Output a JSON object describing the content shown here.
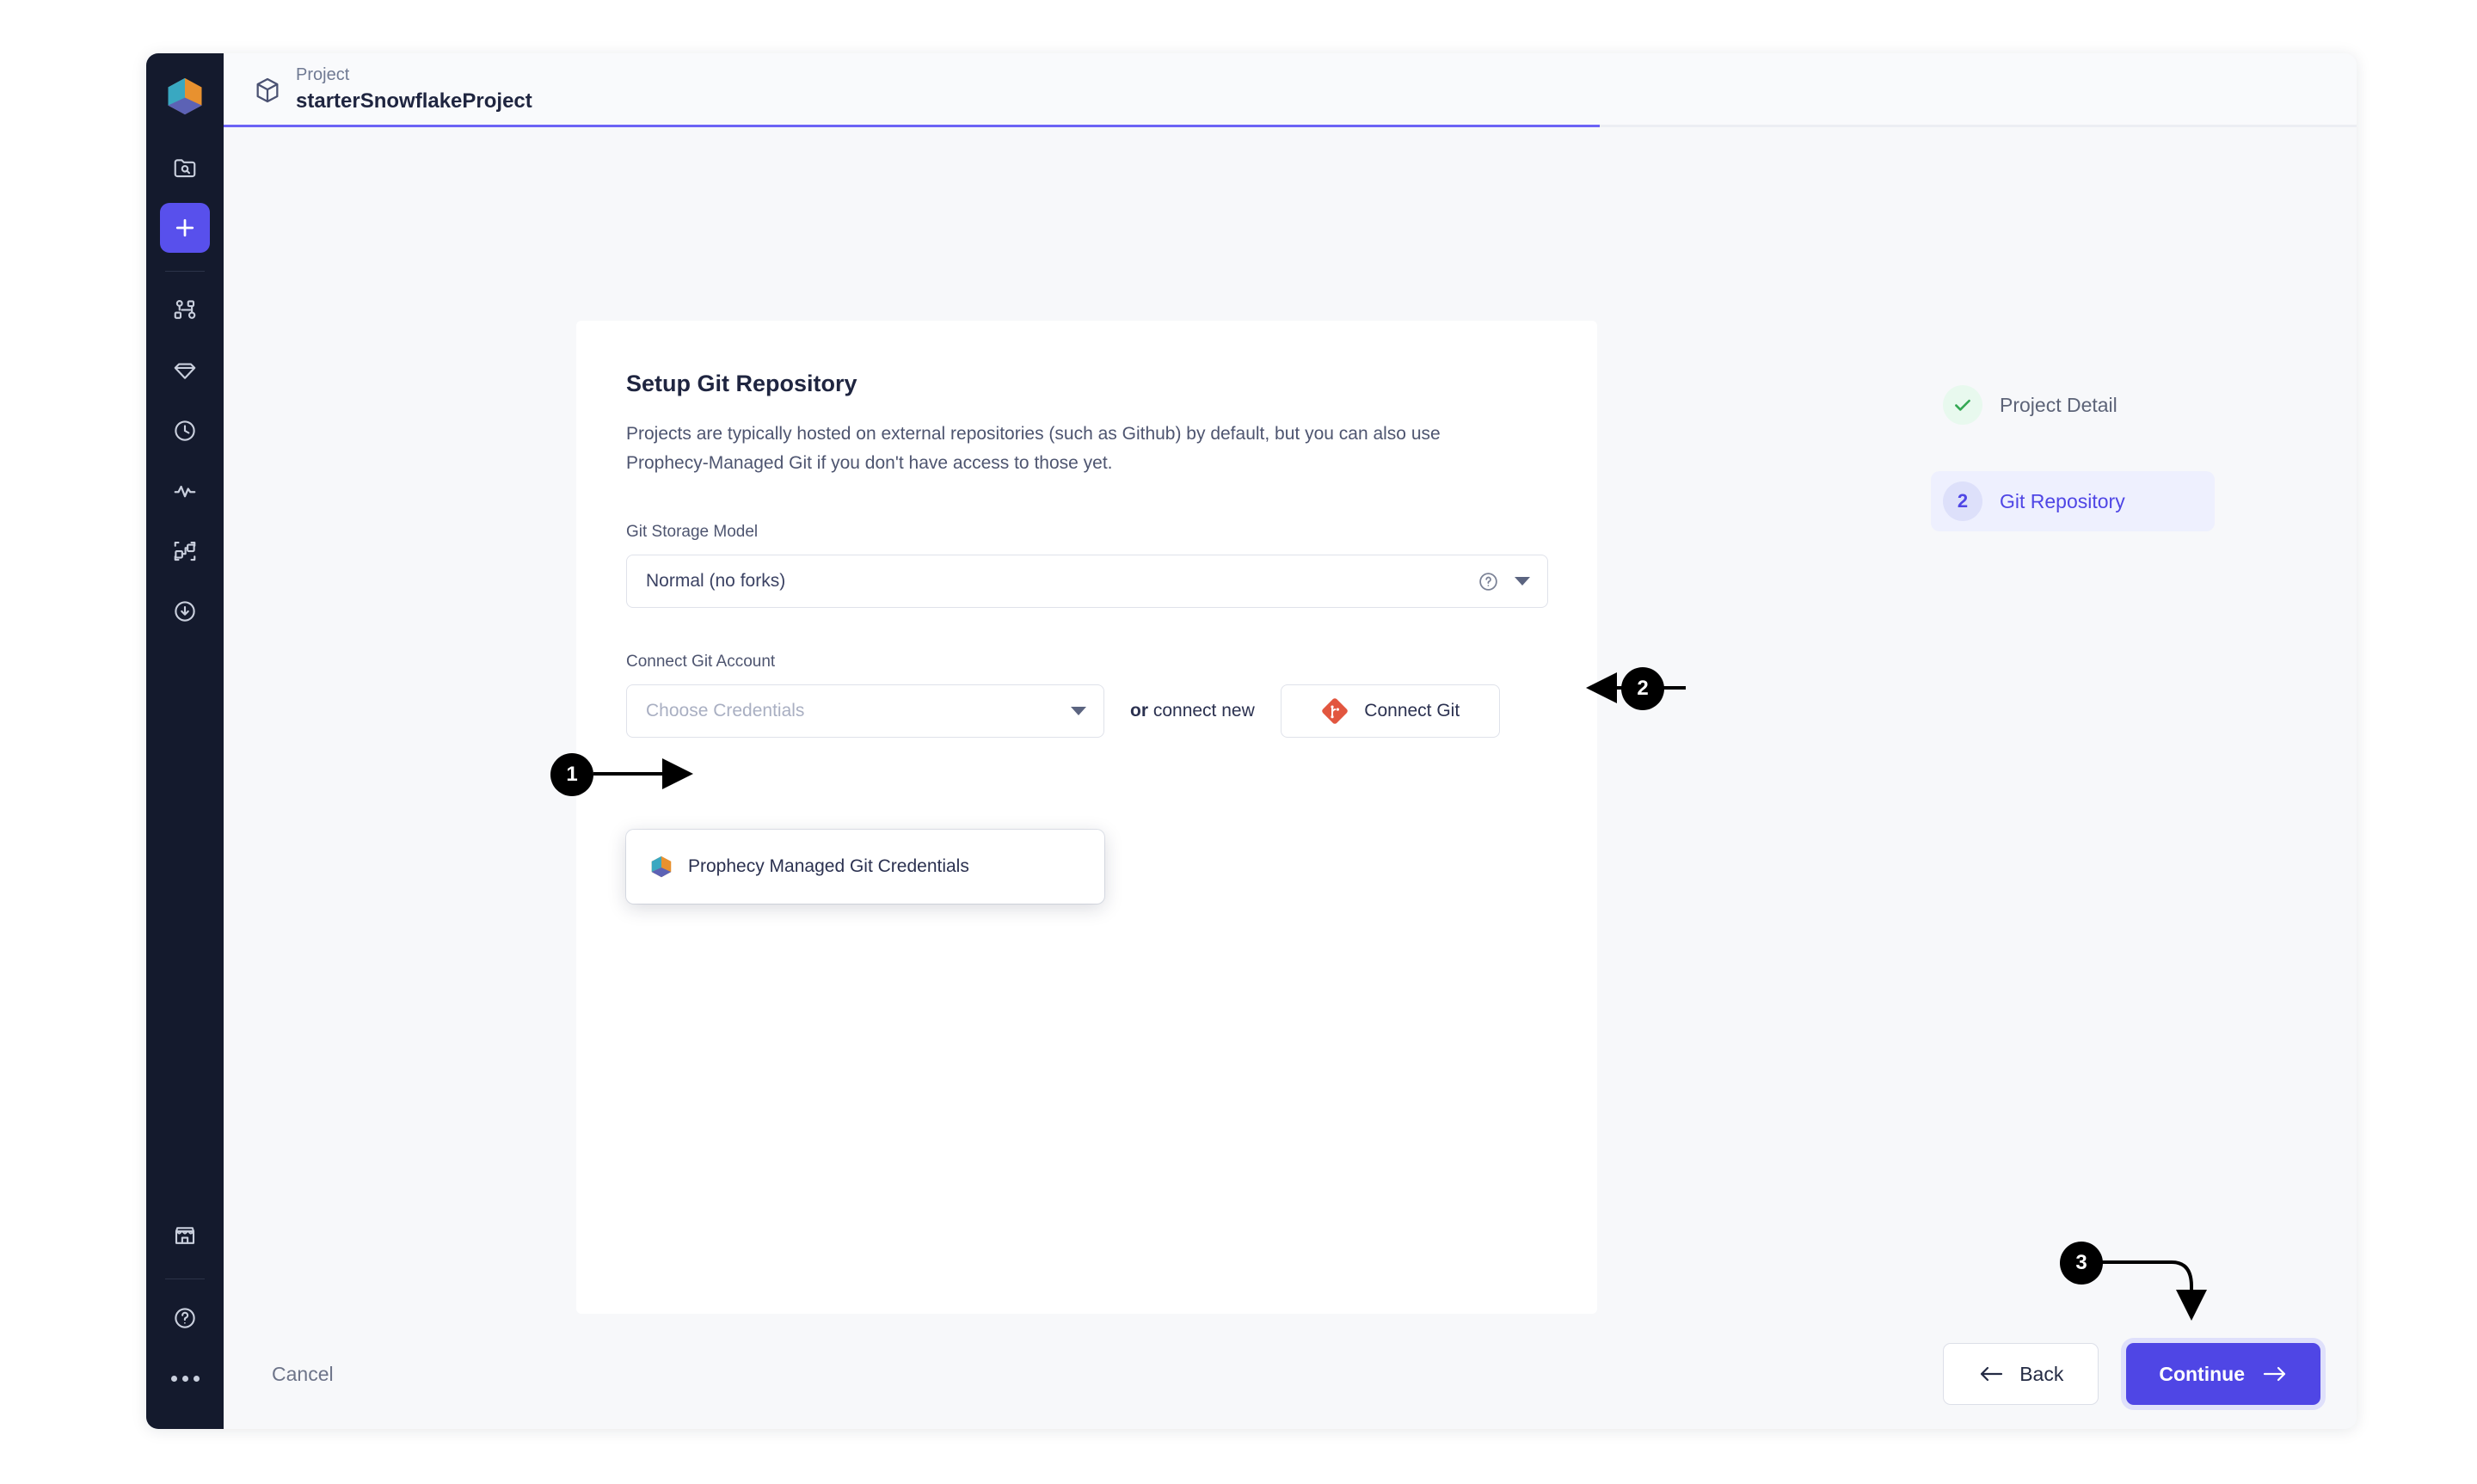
{
  "header": {
    "breadcrumb_label": "Project",
    "breadcrumb_title": "starterSnowflakeProject",
    "cube_icon": "cube-icon",
    "progress_percent": 64.5
  },
  "sidebar": {
    "logo_icon": "prophecy-logo-icon",
    "items": [
      {
        "icon": "folder-search-icon",
        "active": false
      },
      {
        "icon": "plus-icon",
        "active": true
      },
      {
        "icon": "pipeline-nodes-icon",
        "active": false
      },
      {
        "icon": "gem-icon",
        "active": false
      },
      {
        "icon": "clock-icon",
        "active": false
      },
      {
        "icon": "activity-pulse-icon",
        "active": false
      },
      {
        "icon": "graph-nodes-icon",
        "active": false
      },
      {
        "icon": "download-circle-icon",
        "active": false
      }
    ],
    "bottom_items": [
      {
        "icon": "store-icon"
      },
      {
        "icon": "help-circle-icon"
      },
      {
        "icon": "more-dots-icon"
      }
    ]
  },
  "card": {
    "title": "Setup Git Repository",
    "description": "Projects are typically hosted on external repositories (such as Github) by default, but you can also use Prophecy-Managed Git if you don't have access to those yet.",
    "storage_model": {
      "label": "Git Storage Model",
      "value": "Normal (no forks)",
      "help_icon": "help-circle-icon",
      "caret_icon": "chevron-down-icon"
    },
    "connect_account": {
      "label": "Connect Git Account",
      "credentials_placeholder": "Choose Credentials",
      "caret_icon": "chevron-down-icon",
      "or_prefix": "or",
      "or_suffix": " connect new",
      "connect_button_label": "Connect Git",
      "connect_button_icon": "git-logo-icon"
    },
    "dropdown": {
      "options": [
        {
          "label": "Prophecy Managed Git Credentials",
          "icon": "prophecy-logo-icon"
        }
      ]
    }
  },
  "stepper": {
    "steps": [
      {
        "badge": "✓",
        "label": "Project Detail",
        "state": "done"
      },
      {
        "badge": "2",
        "label": "Git Repository",
        "state": "current"
      }
    ]
  },
  "footer": {
    "cancel_label": "Cancel",
    "back_label": "Back",
    "back_icon": "arrow-left-icon",
    "continue_label": "Continue",
    "continue_icon": "arrow-right-icon"
  },
  "annotations": [
    {
      "number": "1",
      "target": "credentials-dropdown-option"
    },
    {
      "number": "2",
      "target": "connect-git-button"
    },
    {
      "number": "3",
      "target": "continue-button"
    }
  ],
  "colors": {
    "accent": "#4f46e5",
    "sidebar_bg": "#141a2d",
    "page_bg": "#f7f8fa",
    "git_red": "#e2563f",
    "success_green": "#34a853"
  }
}
